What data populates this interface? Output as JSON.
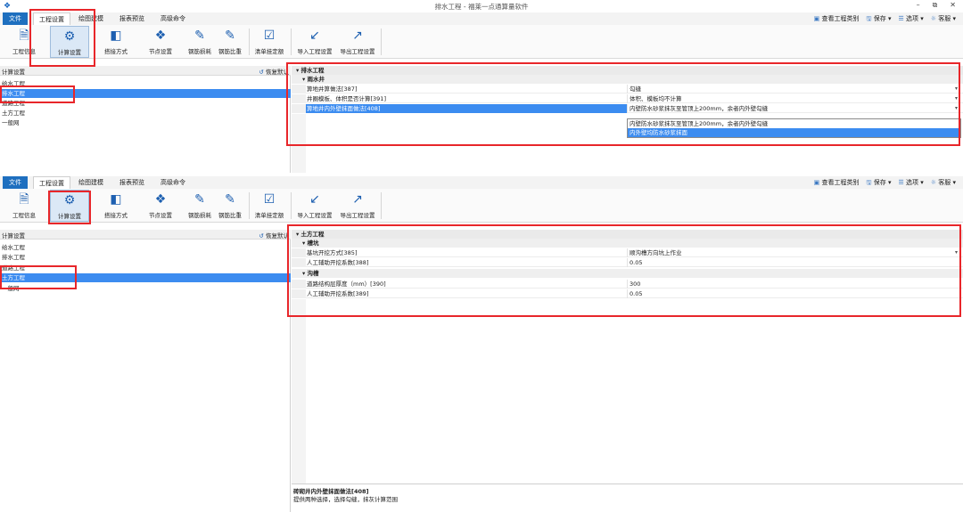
{
  "window": {
    "title": "排水工程 - 福莱一点通算量软件",
    "controls": [
      "–",
      "⧉",
      "✕"
    ]
  },
  "ribbon": {
    "file_tab": "文件",
    "tabs": [
      "工程设置",
      "绘图建模",
      "报表预览",
      "高级命令"
    ],
    "right": {
      "project_type": "查看工程类别",
      "save": "保存",
      "options": "选项",
      "service": "客服"
    },
    "tools": [
      {
        "label": "工程信息",
        "icon": "project-info-icon"
      },
      {
        "label": "计算设置",
        "icon": "calc-settings-icon"
      },
      {
        "label": "搭接方式",
        "icon": "lap-mode-icon"
      },
      {
        "label": "节点设置",
        "icon": "node-settings-icon"
      },
      {
        "label": "钢筋损耗",
        "icon": "rebar-loss-icon"
      },
      {
        "label": "钢筋比重",
        "icon": "rebar-weight-icon"
      },
      {
        "label": "清单挂定额",
        "icon": "bill-quota-icon"
      },
      {
        "label": "导入工程设置",
        "icon": "import-icon"
      },
      {
        "label": "导出工程设置",
        "icon": "export-icon"
      }
    ]
  },
  "top_pane": {
    "left": {
      "header": "计算设置",
      "restore": "恢复默认",
      "items": [
        "给水工程",
        "排水工程",
        "道路工程",
        "土方工程",
        "一般网"
      ],
      "selected": 1
    },
    "right": {
      "group": "排水工程",
      "subgroup": "雨水井",
      "rows": [
        {
          "key": "箅地井箅做法[387]",
          "value": "勾缝",
          "dropdown": true
        },
        {
          "key": "井圈模板、体积是否计算[391]",
          "value": "体积、模板均不计算",
          "dropdown": true
        },
        {
          "key": "箅地井内外壁抹面做法[408]",
          "value": "内壁防水砂浆抹灰至管顶上200mm，余者内外壁勾缝",
          "dropdown": true,
          "selected": true
        }
      ],
      "dropdown_options": [
        "内壁防水砂浆抹灰至管顶上200mm，余者内外壁勾缝",
        "内外壁均防水砂浆抹面"
      ],
      "dropdown_highlight": 1
    }
  },
  "bottom_pane": {
    "left": {
      "header": "计算设置",
      "restore": "恢复默认",
      "items": [
        "给水工程",
        "排水工程",
        "道路工程",
        "土方工程",
        "一般网"
      ],
      "selected": 3
    },
    "right": {
      "group": "土方工程",
      "sections": [
        {
          "name": "槽坑",
          "rows": [
            {
              "key": "基坑开挖方式[385]",
              "value": "顺沟槽方向坑上作业",
              "dropdown": true
            },
            {
              "key": "人工辅助开挖系数[388]",
              "value": "0.05"
            }
          ]
        },
        {
          "name": "沟槽",
          "rows": [
            {
              "key": "道路结构层厚度（mm）[390]",
              "value": "300"
            },
            {
              "key": "人工辅助开挖系数[389]",
              "value": "0.05"
            }
          ]
        }
      ]
    },
    "description": {
      "title": "砖砌井内外壁抹面做法[408]",
      "body": "提供两种选择，选择勾缝，抹灰计算范围"
    }
  }
}
